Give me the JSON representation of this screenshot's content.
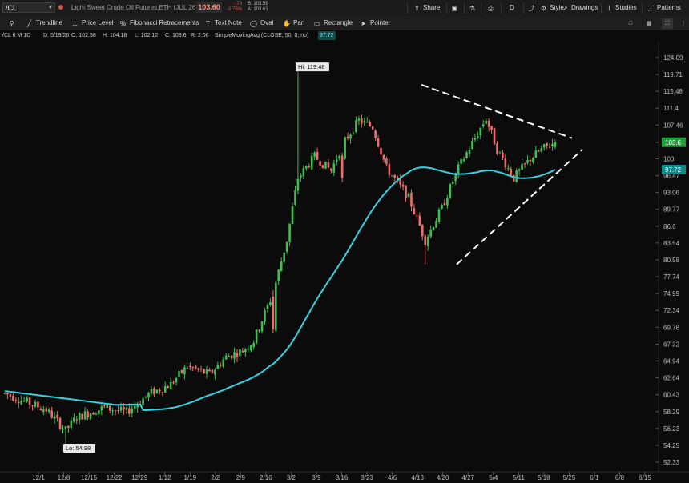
{
  "header": {
    "symbol": "/CL",
    "symbol_dropdown_icon": "chevron-down-icon",
    "description": "Light Sweet Crude Oil Futures,ETH (JUL 26)",
    "last_price": "103.60",
    "change": "-.78",
    "change_pct": "-0.75%",
    "bid": "B: 103.59",
    "ask": "A: 103.61",
    "buttons": {
      "share": "Share",
      "style": "Style",
      "drawings": "Drawings",
      "studies": "Studies",
      "patterns": "Patterns",
      "period": "D"
    }
  },
  "drawing_tools": {
    "trendline": "Trendline",
    "price_level": "Price Level",
    "fibonacci": "Fibonacci Retracements",
    "text_note": "Text Note",
    "oval": "Oval",
    "pan": "Pan",
    "rectangle": "Rectangle",
    "pointer": "Pointer"
  },
  "info": {
    "title": "/CL 6 M 1D",
    "date": "D: 5/19/26",
    "open": "O: 102.58",
    "high": "H: 104.18",
    "low": "L: 102.12",
    "close": "C: 103.6",
    "range": "R: 2.06",
    "study": "SimpleMovingAvg (CLOSE, 50, 0, no)",
    "study_value": "97.72"
  },
  "colors": {
    "up": "#3fbf4f",
    "down": "#f06b6b",
    "sma": "#34d3e0",
    "price_tag": "#1f9e3a",
    "sma_tag": "#0f8a8a",
    "drawing": "#ffffff"
  },
  "chart_data": {
    "type": "candlestick",
    "y_ticks": [
      "124.09",
      "119.71",
      "115.48",
      "111.4",
      "107.46",
      "103.6",
      "100",
      "96.47",
      "93.06",
      "89.77",
      "86.6",
      "83.54",
      "80.58",
      "77.74",
      "74.99",
      "72.34",
      "69.78",
      "67.32",
      "64.94",
      "62.64",
      "60.43",
      "58.29",
      "56.23",
      "54.25",
      "52.33"
    ],
    "x_ticks": [
      "12/1",
      "12/8",
      "12/15",
      "12/22",
      "12/29",
      "1/12",
      "1/19",
      "2/2",
      "2/9",
      "2/16",
      "3/2",
      "3/9",
      "3/16",
      "3/23",
      "4/6",
      "4/13",
      "4/20",
      "4/27",
      "5/4",
      "5/11",
      "5/18",
      "5/25",
      "6/1",
      "6/8",
      "6/15"
    ],
    "ylim": [
      52.33,
      124.09
    ],
    "price_label": "103.6",
    "sma_label": "97.72",
    "annotations": {
      "high": "Hi: 119.48",
      "low": "Lo: 54.98"
    }
  }
}
